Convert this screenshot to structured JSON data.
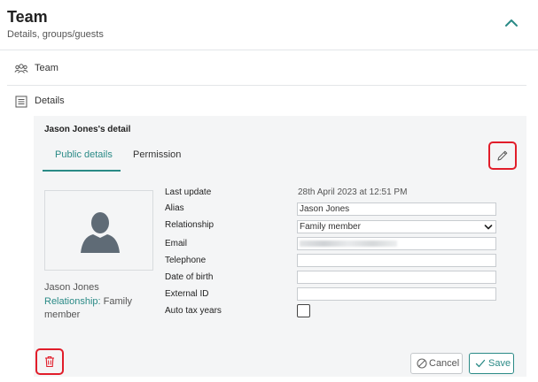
{
  "header": {
    "title": "Team",
    "subtitle": "Details, groups/guests",
    "collapse_icon": "chevron-up-icon"
  },
  "sections": {
    "team": {
      "label": "Team",
      "icon": "team-icon"
    },
    "details": {
      "label": "Details",
      "icon": "list-icon"
    }
  },
  "card": {
    "title": "Jason Jones's detail",
    "tabs": [
      {
        "label": "Public details",
        "active": true
      },
      {
        "label": "Permission",
        "active": false
      }
    ],
    "edit_icon": "pencil-icon",
    "person": {
      "name": "Jason Jones",
      "relationship_key": "Relationship:",
      "relationship_value": "Family member"
    },
    "fields": {
      "last_update": {
        "label": "Last update",
        "value": "28th April 2023 at 12:51 PM"
      },
      "alias": {
        "label": "Alias",
        "value": "Jason Jones"
      },
      "relationship": {
        "label": "Relationship",
        "value": "Family member"
      },
      "email": {
        "label": "Email",
        "value": ""
      },
      "telephone": {
        "label": "Telephone",
        "value": ""
      },
      "date_of_birth": {
        "label": "Date of birth",
        "value": ""
      },
      "external_id": {
        "label": "External ID",
        "value": ""
      },
      "auto_tax_years": {
        "label": "Auto tax years",
        "checked": false
      }
    },
    "actions": {
      "delete_icon": "trash-icon",
      "cancel_label": "Cancel",
      "save_label": "Save"
    }
  },
  "colors": {
    "accent": "#2a8a86",
    "highlight_border": "#e11d2a",
    "card_background": "#f4f5f6"
  }
}
